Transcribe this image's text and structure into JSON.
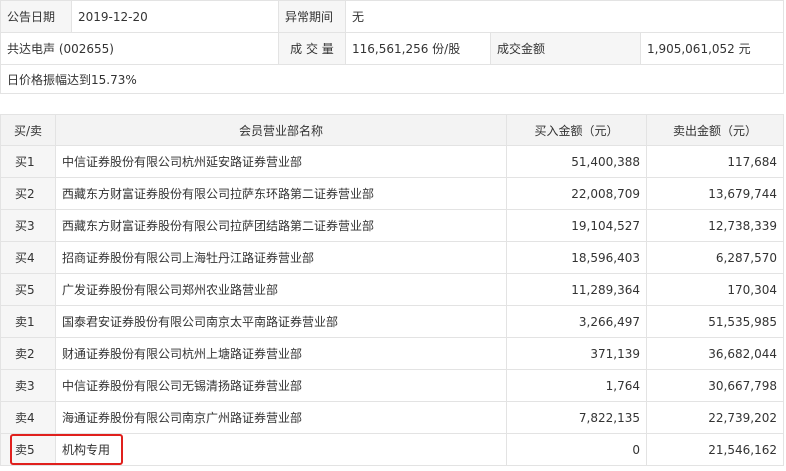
{
  "info": {
    "date_label": "公告日期",
    "date_value": "2019-12-20",
    "anomaly_label": "异常期间",
    "anomaly_value": "无",
    "stock_name": "共达电声 (002655)",
    "volume_label": "成 交 量",
    "volume_value": "116,561,256 份/股",
    "amount_label": "成交金额",
    "amount_value": "1,905,061,052 元",
    "note": "日价格振幅达到15.73%"
  },
  "table": {
    "headers": {
      "side": "买/卖",
      "dept": "会员营业部名称",
      "buy": "买入金额（元）",
      "sell": "卖出金额（元）"
    },
    "rows": [
      {
        "side": "买1",
        "dept": "中信证券股份有限公司杭州延安路证券营业部",
        "buy": "51,400,388",
        "sell": "117,684"
      },
      {
        "side": "买2",
        "dept": "西藏东方财富证券股份有限公司拉萨东环路第二证券营业部",
        "buy": "22,008,709",
        "sell": "13,679,744"
      },
      {
        "side": "买3",
        "dept": "西藏东方财富证券股份有限公司拉萨团结路第二证券营业部",
        "buy": "19,104,527",
        "sell": "12,738,339"
      },
      {
        "side": "买4",
        "dept": "招商证券股份有限公司上海牡丹江路证券营业部",
        "buy": "18,596,403",
        "sell": "6,287,570"
      },
      {
        "side": "买5",
        "dept": "广发证券股份有限公司郑州农业路营业部",
        "buy": "11,289,364",
        "sell": "170,304"
      },
      {
        "side": "卖1",
        "dept": "国泰君安证券股份有限公司南京太平南路证券营业部",
        "buy": "3,266,497",
        "sell": "51,535,985"
      },
      {
        "side": "卖2",
        "dept": "财通证券股份有限公司杭州上塘路证券营业部",
        "buy": "371,139",
        "sell": "36,682,044"
      },
      {
        "side": "卖3",
        "dept": "中信证券股份有限公司无锡清扬路证券营业部",
        "buy": "1,764",
        "sell": "30,667,798"
      },
      {
        "side": "卖4",
        "dept": "海通证券股份有限公司南京广州路证券营业部",
        "buy": "7,822,135",
        "sell": "22,739,202"
      },
      {
        "side": "卖5",
        "dept": "机构专用",
        "buy": "0",
        "sell": "21,546,162"
      }
    ]
  },
  "colors": {
    "highlight_border": "#e0201d",
    "header_bg": "#f3f3f3",
    "label_bg": "#f6f6f6",
    "grid": "#e3e3e3"
  }
}
